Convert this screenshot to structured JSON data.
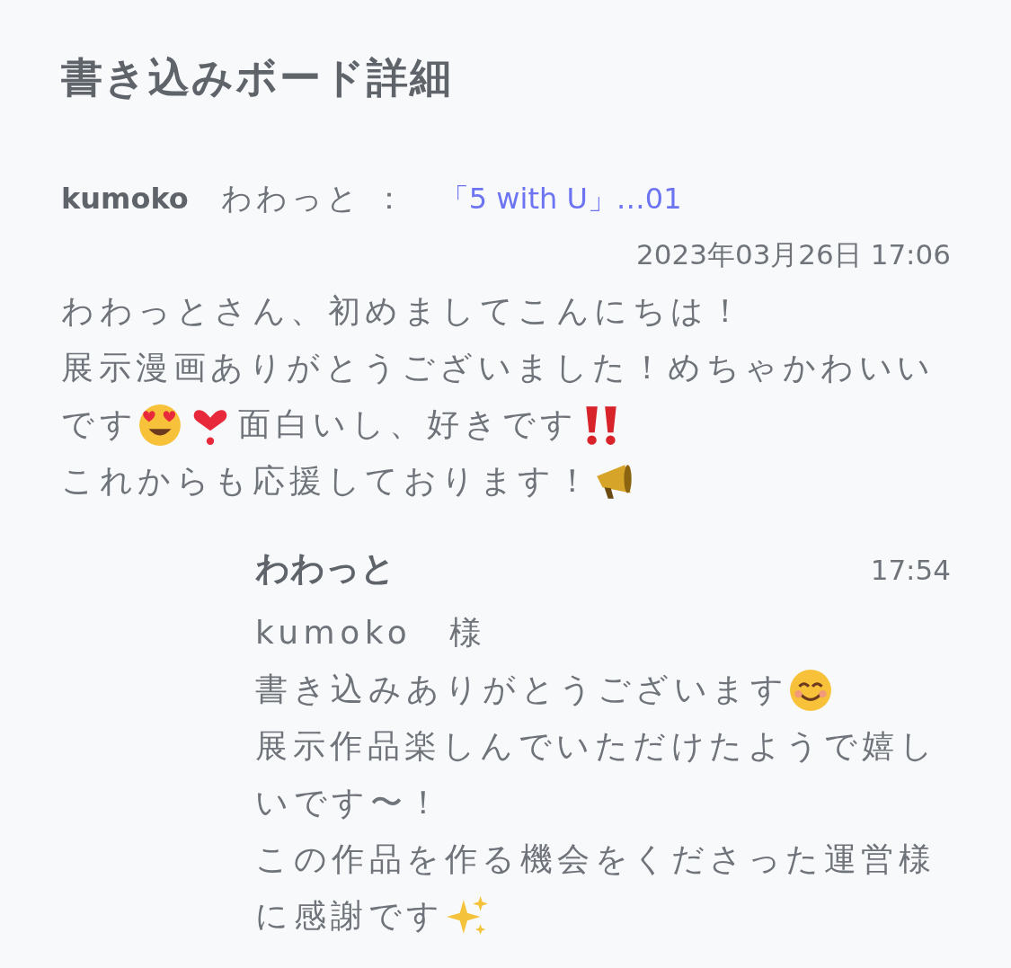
{
  "title": "書き込みボード詳細",
  "post": {
    "author": "kumoko",
    "recipient": "わわっと",
    "separator": "：",
    "link": "「5 with U」…01",
    "date": "2023年03月26日 17:06",
    "lines": [
      {
        "segments": [
          {
            "kind": "text",
            "text": "わわっとさん、初めましてこんにちは！"
          }
        ]
      },
      {
        "segments": [
          {
            "kind": "text",
            "text": "展示漫画ありがとうございました！めちゃかわいい"
          }
        ]
      },
      {
        "segments": [
          {
            "kind": "text",
            "text": "です"
          },
          {
            "kind": "heart-eyes"
          },
          {
            "kind": "heart-exclamation"
          },
          {
            "kind": "text",
            "text": " 面白いし、好きです"
          },
          {
            "kind": "double-exclamation"
          }
        ]
      },
      {
        "segments": [
          {
            "kind": "text",
            "text": "これからも応援しております！"
          },
          {
            "kind": "megaphone"
          }
        ]
      }
    ]
  },
  "reply": {
    "author": "わわっと",
    "time": "17:54",
    "lines": [
      {
        "segments": [
          {
            "kind": "text",
            "text": "kumoko　様"
          }
        ]
      },
      {
        "segments": [
          {
            "kind": "text",
            "text": "書き込みありがとうございます"
          },
          {
            "kind": "smile"
          }
        ]
      },
      {
        "segments": [
          {
            "kind": "text",
            "text": "展示作品楽しんでいただけたようで嬉し"
          }
        ]
      },
      {
        "segments": [
          {
            "kind": "text",
            "text": "いです〜！"
          }
        ]
      },
      {
        "segments": [
          {
            "kind": "text",
            "text": "この作品を作る機会をくださった運営様"
          }
        ]
      },
      {
        "segments": [
          {
            "kind": "text",
            "text": "に感謝です"
          },
          {
            "kind": "sparkles"
          }
        ]
      }
    ]
  }
}
